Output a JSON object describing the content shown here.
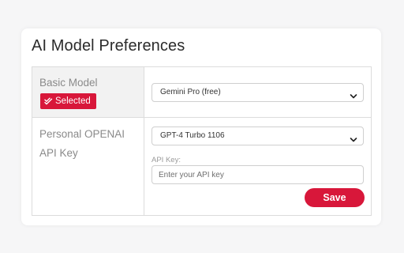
{
  "card": {
    "title": "AI Model Preferences"
  },
  "rows": {
    "basic_model": {
      "label": "Basic Model",
      "badge": "Selected",
      "badge_icon": "double-check-icon",
      "select_value": "Gemini Pro (free)"
    },
    "personal_openai": {
      "label": "Personal OPENAI API Key",
      "select_value": "GPT-4 Turbo 1106",
      "api_key_label": "API Key:",
      "api_key_placeholder": "Enter your API key",
      "api_key_value": "",
      "save_label": "Save"
    }
  },
  "colors": {
    "accent": "#d8173a",
    "label_gray": "#8a8a8a",
    "header_row_bg": "#f2f2f2"
  }
}
